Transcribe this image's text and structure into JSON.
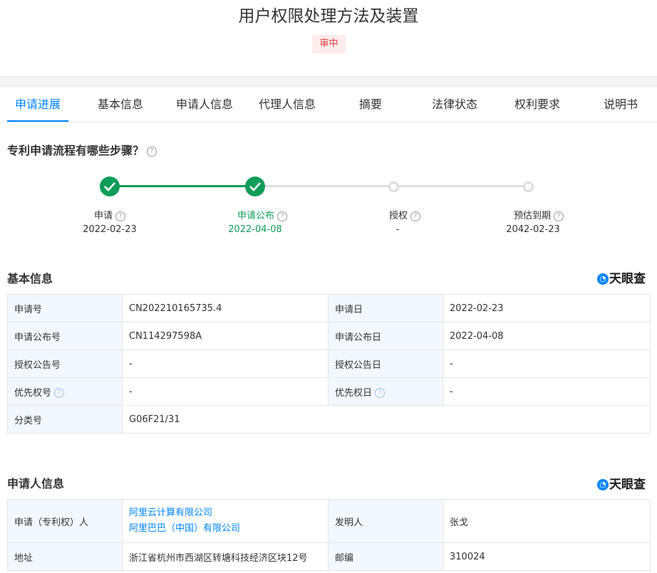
{
  "header": {
    "title": "用户权限处理方法及装置",
    "status": "审中"
  },
  "tabs": [
    "申请进展",
    "基本信息",
    "申请人信息",
    "代理人信息",
    "摘要",
    "法律状态",
    "权利要求",
    "说明书"
  ],
  "progress": {
    "heading": "专利申请流程有哪些步骤？",
    "steps": [
      {
        "label": "申请",
        "date": "2022-02-23",
        "done": true
      },
      {
        "label": "申请公布",
        "date": "2022-04-08",
        "done": true
      },
      {
        "label": "授权",
        "date": "-",
        "done": false
      },
      {
        "label": "预估到期",
        "date": "2042-02-23",
        "done": false
      }
    ],
    "done_color": "#0f9d58"
  },
  "brand": "天眼查",
  "basic": {
    "heading": "基本信息",
    "rows": [
      {
        "k1": "申请号",
        "v1": "CN202210165735.4",
        "k2": "申请日",
        "v2": "2022-02-23"
      },
      {
        "k1": "申请公布号",
        "v1": "CN114297598A",
        "k2": "申请公布日",
        "v2": "2022-04-08"
      },
      {
        "k1": "授权公告号",
        "v1": "-",
        "k2": "授权公告日",
        "v2": "-"
      },
      {
        "k1": "优先权号",
        "v1": "-",
        "k2": "优先权日",
        "v2": "-"
      },
      {
        "k1": "分类号",
        "v1": "G06F21/31"
      }
    ]
  },
  "applicant": {
    "heading": "申请人信息",
    "applicant_label": "申请（专利权）人",
    "applicants": [
      "阿里云计算有限公司",
      "阿里巴巴（中国）有限公司"
    ],
    "inventor_label": "发明人",
    "inventor": "张戈",
    "address_label": "地址",
    "address": "浙江省杭州市西湖区转塘科技经济区块12号",
    "postcode_label": "邮编",
    "postcode": "310024"
  },
  "colors": {
    "accent": "#0084ff",
    "status": "#e23b3b",
    "key_bg": "#f2f8ff"
  }
}
